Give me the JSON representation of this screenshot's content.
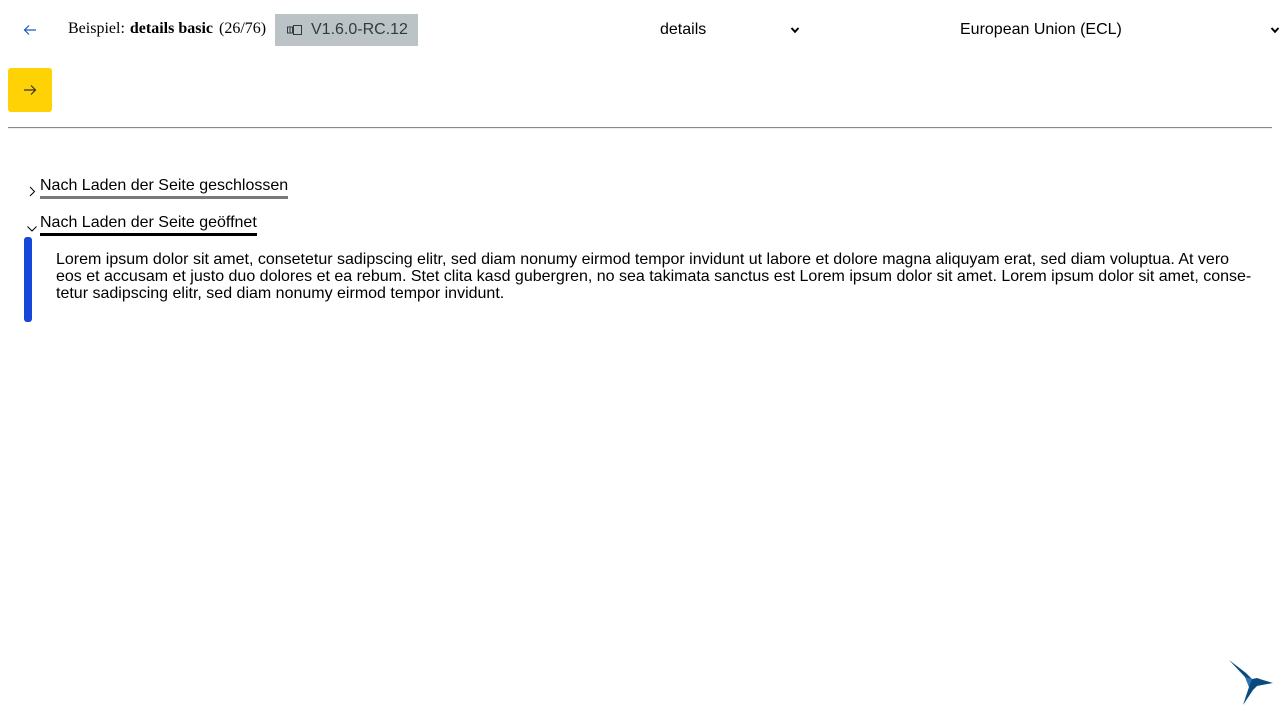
{
  "toolbar": {
    "back_icon": "arrow-left-icon",
    "example_prefix": "Beispiel:",
    "example_name": "details basic",
    "example_count": "(26/76)",
    "version_icon": "toggle-icon",
    "version_label": "V1.6.0-RC.12",
    "component_select": {
      "value": "details"
    },
    "theme_select": {
      "value": "European Union (ECL)"
    },
    "next_icon": "arrow-right-icon"
  },
  "details": [
    {
      "summary": "Nach Laden der Seite geschlossen",
      "state": "closed"
    },
    {
      "summary": "Nach Laden der Seite geöffnet",
      "state": "open",
      "content": "Lorem ipsum dolor sit amet, consetetur sadipscing elitr, sed diam nonumy eirmod tempor invidunt ut labore et dolore magna aliquyam erat, sed diam voluptua. At vero eos et accusam et justo duo dolores et ea rebum. Stet clita kasd gubergren, no sea takimata sanctus est Lorem ipsum dolor sit amet. Lorem ipsum dolor sit amet, conse­tetur sadipscing elitr, sed diam nonumy eirmod tempor invidunt."
    }
  ],
  "logo": "kolibri-bird-logo",
  "colors": {
    "accent_yellow": "#ffd205",
    "accent_blue": "#1747d8",
    "link_blue": "#1a57c8",
    "badge_grey": "#bcc3c6",
    "logo_blue": "#0a4b7e"
  }
}
